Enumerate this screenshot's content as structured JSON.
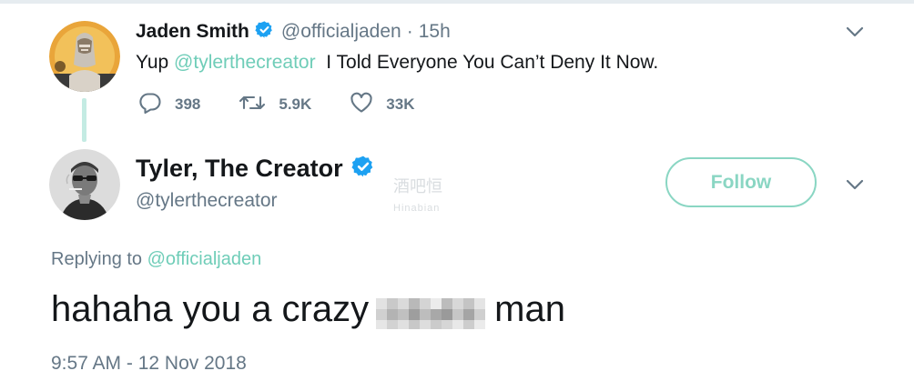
{
  "parent_tweet": {
    "author_name": "Jaden Smith",
    "handle": "@officialjaden",
    "separator": "·",
    "time": "15h",
    "text_prefix": "Yup ",
    "mention": "@tylerthecreator",
    "text_suffix": "  I Told Everyone You Can’t Deny It Now.",
    "replies": "398",
    "retweets": "5.9K",
    "likes": "33K",
    "avatar_icon": "user-avatar-icon",
    "verified_icon": "verified-badge-icon",
    "caret_icon": "chevron-down-icon"
  },
  "main_tweet": {
    "author_name": "Tyler, The Creator",
    "handle": "@tylerthecreator",
    "follow_label": "Follow",
    "replying_label": "Replying to ",
    "replying_mention": "@officialjaden",
    "text_before": "hahaha you a crazy",
    "text_after": "man",
    "timestamp": "9:57 AM - 12 Nov 2018",
    "avatar_icon": "user-avatar-icon",
    "verified_icon": "verified-badge-icon",
    "caret_icon": "chevron-down-icon"
  },
  "watermark": {
    "cn": "酒吧恒",
    "en": "Hinabian"
  },
  "colors": {
    "accent": "#6fcdb8",
    "follow_border": "#8ad6c3",
    "verified": "#1da1f2",
    "muted": "#657786",
    "text": "#14171a",
    "thread_line": "#c4ebe3"
  }
}
